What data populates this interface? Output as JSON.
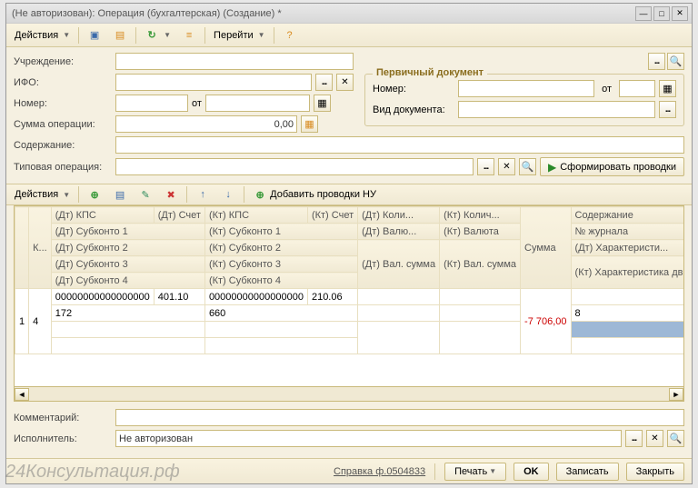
{
  "title": "(Не авторизован): Операция (бухгалтерская) (Создание) *",
  "toolbar": {
    "actions": "Действия",
    "goto": "Перейти"
  },
  "labels": {
    "institution": "Учреждение:",
    "ifo": "ИФО:",
    "number": "Номер:",
    "from": "от",
    "sum": "Сумма операции:",
    "content": "Содержание:",
    "typical": "Типовая операция:",
    "comment": "Комментарий:",
    "executor": "Исполнитель:"
  },
  "values": {
    "sum": "0,00",
    "executor": "Не авторизован"
  },
  "primary_doc": {
    "title": "Первичный документ",
    "number": "Номер:",
    "from": "от",
    "doc_type": "Вид документа:"
  },
  "buttons": {
    "generate": "Сформировать проводки",
    "add_nu": "Добавить проводки НУ"
  },
  "sub_toolbar": {
    "actions": "Действия"
  },
  "grid": {
    "headers": {
      "k": "К...",
      "dt_kps": "(Дт) КПС",
      "dt_account": "(Дт) Счет",
      "kt_kps": "(Кт) КПС",
      "kt_account": "(Кт) Счет",
      "dt_qty": "(Дт) Коли...",
      "kt_qty": "(Кт) Колич...",
      "sum": "Сумма",
      "content": "Содержание",
      "dt_sub1": "(Дт) Субконто 1",
      "kt_sub1": "(Кт) Субконто 1",
      "dt_cur": "(Дт) Валю...",
      "kt_cur": "(Кт) Валюта",
      "journal": "№ журнала",
      "dt_sub2": "(Дт) Субконто 2",
      "kt_sub2": "(Кт) Субконто 2",
      "dt_csum": "(Дт) Вал. сумма",
      "kt_csum": "(Кт) Вал. сумма",
      "dt_char": "(Дт) Характеристи...",
      "dt_sub3": "(Дт) Субконто 3",
      "kt_sub3": "(Кт) Субконто 3",
      "kt_char": "(Кт) Характеристика движения",
      "dt_sub4": "(Дт) Субконто 4",
      "kt_sub4": "(Кт) Субконто 4"
    },
    "row": {
      "n": "1",
      "k": "4",
      "dt_kps": "00000000000000000",
      "dt_acc": "401.10",
      "kt_kps": "00000000000000000",
      "kt_acc": "210.06",
      "sum": "-7 706,00",
      "dt_s1": "172",
      "kt_s1": "660",
      "journal": "8"
    }
  },
  "footer": {
    "ref": "Справка ф.0504833",
    "print": "Печать",
    "ok": "OK",
    "save": "Записать",
    "close": "Закрыть"
  },
  "watermark": "24Консультация.рф"
}
